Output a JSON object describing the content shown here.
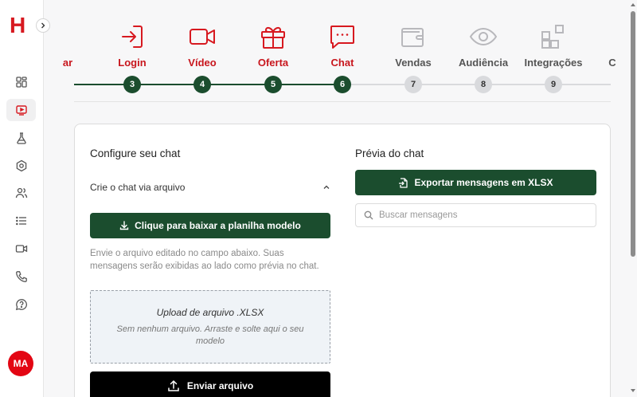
{
  "app": {
    "logo_text": "H",
    "avatar_initials": "MA"
  },
  "sidebar": {
    "items": [
      {
        "icon": "dashboard-icon"
      },
      {
        "icon": "tv-play-icon",
        "active": true
      },
      {
        "icon": "flask-icon"
      },
      {
        "icon": "hexagon-icon"
      },
      {
        "icon": "users-icon"
      },
      {
        "icon": "list-icon"
      },
      {
        "icon": "video-camera-icon"
      },
      {
        "icon": "phone-icon"
      },
      {
        "icon": "help-chat-icon"
      }
    ]
  },
  "stepper": {
    "steps": [
      {
        "label": "ar",
        "number": "",
        "status": "done",
        "icon": "truncated"
      },
      {
        "label": "Login",
        "number": "3",
        "status": "done",
        "icon": "login-icon"
      },
      {
        "label": "Vídeo",
        "number": "4",
        "status": "done",
        "icon": "video-icon"
      },
      {
        "label": "Oferta",
        "number": "5",
        "status": "done",
        "icon": "gift-icon"
      },
      {
        "label": "Chat",
        "number": "6",
        "status": "done",
        "icon": "chat-icon"
      },
      {
        "label": "Vendas",
        "number": "7",
        "status": "todo",
        "icon": "wallet-icon"
      },
      {
        "label": "Audiência",
        "number": "8",
        "status": "todo",
        "icon": "eye-icon"
      },
      {
        "label": "Integrações",
        "number": "9",
        "status": "todo",
        "icon": "integrations-icon"
      },
      {
        "label": "C",
        "number": "",
        "status": "todo",
        "icon": "truncated"
      }
    ],
    "colors": {
      "done": "#1b4d2e",
      "todo": "#d9dadd",
      "done_label": "#c8161d"
    }
  },
  "config": {
    "title": "Configure seu chat",
    "accordion_label": "Crie o chat via arquivo",
    "download_button": "Clique para baixar a planilha modelo",
    "help_text": "Envie o arquivo editado no campo abaixo. Suas mensagens serão exibidas ao lado como prévia no chat.",
    "upload_title": "Upload de arquivo .XLSX",
    "upload_subtitle": "Sem nenhum arquivo. Arraste e solte aqui o seu modelo",
    "send_button": "Enviar arquivo"
  },
  "preview": {
    "title": "Prévia do chat",
    "export_button": "Exportar mensagens em XLSX",
    "search_placeholder": "Buscar mensagens"
  }
}
